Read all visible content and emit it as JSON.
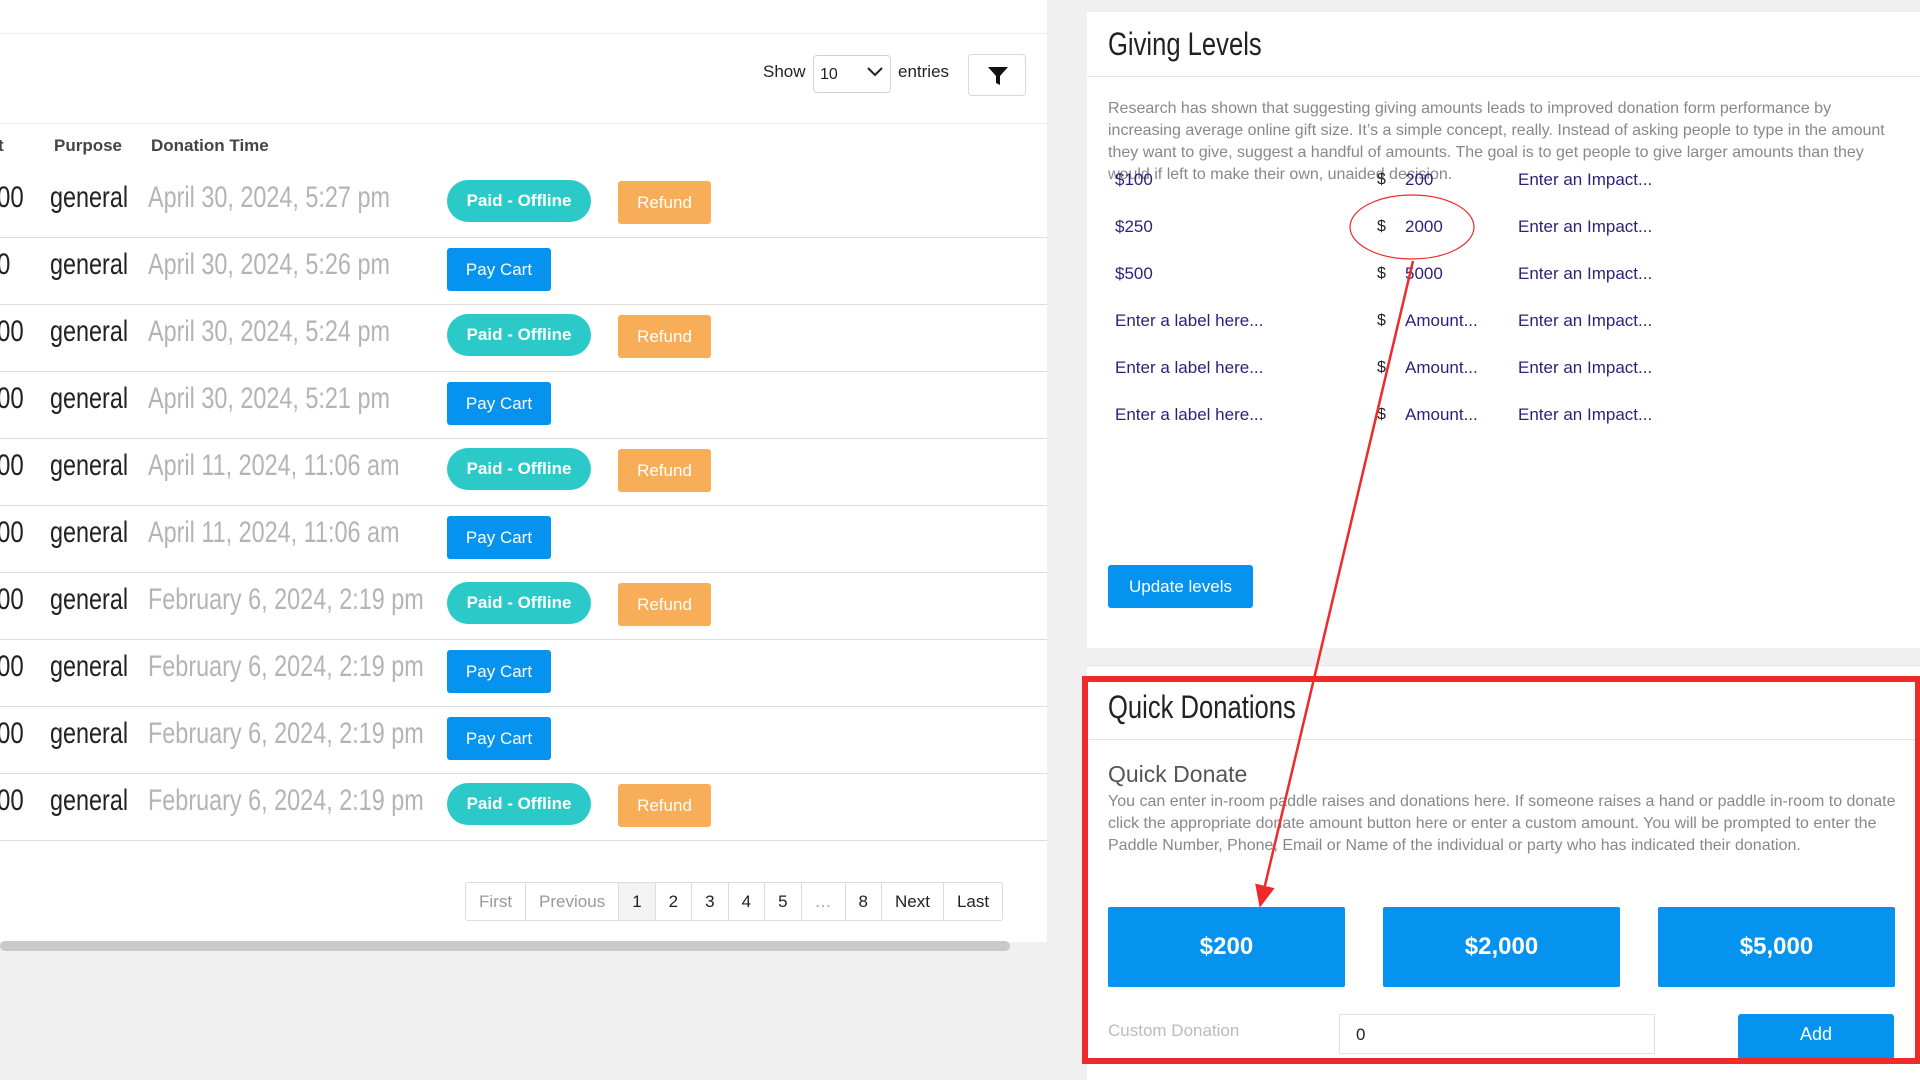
{
  "entries": {
    "show_label": "Show",
    "value": "10",
    "entries_label": "entries"
  },
  "table": {
    "columns": [
      "t",
      "Purpose",
      "Donation Time"
    ],
    "rows": [
      {
        "amount": "00",
        "purpose": "general",
        "time": "April 30, 2024, 5:27 pm",
        "action": "Paid - Offline",
        "refund": "Refund"
      },
      {
        "amount": "0",
        "purpose": "general",
        "time": "April 30, 2024, 5:26 pm",
        "action": "Pay Cart",
        "refund": ""
      },
      {
        "amount": "00",
        "purpose": "general",
        "time": "April 30, 2024, 5:24 pm",
        "action": "Paid - Offline",
        "refund": "Refund"
      },
      {
        "amount": "00",
        "purpose": "general",
        "time": "April 30, 2024, 5:21 pm",
        "action": "Pay Cart",
        "refund": ""
      },
      {
        "amount": "00",
        "purpose": "general",
        "time": "April 11, 2024, 11:06 am",
        "action": "Paid - Offline",
        "refund": "Refund"
      },
      {
        "amount": "00",
        "purpose": "general",
        "time": "April 11, 2024, 11:06 am",
        "action": "Pay Cart",
        "refund": ""
      },
      {
        "amount": "00",
        "purpose": "general",
        "time": "February 6, 2024, 2:19 pm",
        "action": "Paid - Offline",
        "refund": "Refund"
      },
      {
        "amount": "00",
        "purpose": "general",
        "time": "February 6, 2024, 2:19 pm",
        "action": "Pay Cart",
        "refund": ""
      },
      {
        "amount": "00",
        "purpose": "general",
        "time": "February 6, 2024, 2:19 pm",
        "action": "Pay Cart",
        "refund": ""
      },
      {
        "amount": "00",
        "purpose": "general",
        "time": "February 6, 2024, 2:19 pm",
        "action": "Paid - Offline",
        "refund": "Refund"
      }
    ]
  },
  "pagination": [
    "First",
    "Previous",
    "1",
    "2",
    "3",
    "4",
    "5",
    "…",
    "8",
    "Next",
    "Last"
  ],
  "pagination_current": "1",
  "giving_levels": {
    "title": "Giving Levels",
    "description": "Research has shown that suggesting giving amounts leads to improved donation form performance by increasing average online gift size. It’s a simple concept, really. Instead of asking people to type in the amount they want to give, suggest a handful of amounts. The goal is to get people to give larger amounts than they would if left to make their own, unaided decision.",
    "currency": "$",
    "levels": [
      {
        "label": "$100",
        "amount": "200",
        "impact": "Enter an Impact..."
      },
      {
        "label": "$250",
        "amount": "2000",
        "impact": "Enter an Impact..."
      },
      {
        "label": "$500",
        "amount": "5000",
        "impact": "Enter an Impact..."
      },
      {
        "label": "Enter a label here...",
        "amount": "Amount...",
        "impact": "Enter an Impact..."
      },
      {
        "label": "Enter a label here...",
        "amount": "Amount...",
        "impact": "Enter an Impact..."
      },
      {
        "label": "Enter a label here...",
        "amount": "Amount...",
        "impact": "Enter an Impact..."
      }
    ],
    "update_label": "Update levels"
  },
  "quick_donations": {
    "title": "Quick Donations",
    "subtitle": "Quick Donate",
    "description": "You can enter in-room paddle raises and donations here. If someone raises a hand or paddle in-room to donate click the appropriate donate amount button here or enter a custom amount. You will be prompted to enter the Paddle Number, Phone, Email or Name of the individual or party who has indicated their donation.",
    "amounts": [
      "$200",
      "$2,000",
      "$5,000"
    ],
    "custom_label": "Custom Donation",
    "custom_value": "0",
    "add_label": "Add"
  },
  "colors": {
    "annotation": "#ee2a2a",
    "primary": "#0593ef",
    "paid": "#2bcac8",
    "refund": "#f8ad58"
  }
}
